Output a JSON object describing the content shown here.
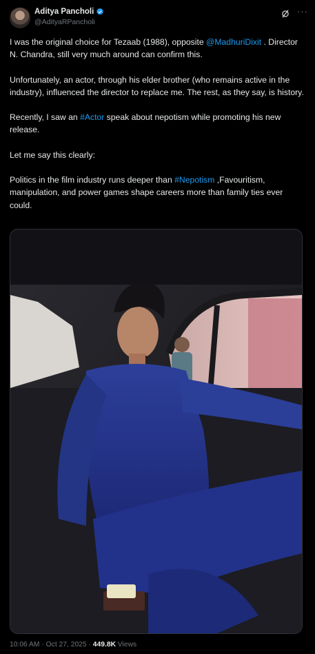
{
  "author": {
    "display_name": "Aditya Pancholi",
    "handle": "@AdityaRPancholi"
  },
  "tweet": {
    "p1_a": "I was the original choice for Tezaab (1988), opposite ",
    "p1_mention": "@MadhuriDixit",
    "p1_b": " . Director N. Chandra, still very much around can confirm this.",
    "p2": "Unfortunately, an actor, through his elder brother (who remains active in the industry), influenced the director to replace me. The rest, as they say, is history.",
    "p3_a": "Recently, I saw an ",
    "p3_hashtag": "#Actor",
    "p3_b": " speak about nepotism while promoting his new release.",
    "p4": "Let me say this clearly:",
    "p5_a": "Politics in the film industry runs deeper than ",
    "p5_hashtag": "#Nepotism",
    "p5_b": " ,Favouritism, manipulation, and power games shape careers more than family ties ever could."
  },
  "meta": {
    "time": "10:06 AM",
    "separator": " · ",
    "date": "Oct 27, 2025",
    "views_count": "449.8K",
    "views_label": " Views"
  },
  "colors": {
    "link": "#1d9bf0",
    "background": "#000000",
    "muted": "#71767b"
  },
  "icons": [
    "verified-badge-icon",
    "grok-icon",
    "more-options-icon"
  ]
}
